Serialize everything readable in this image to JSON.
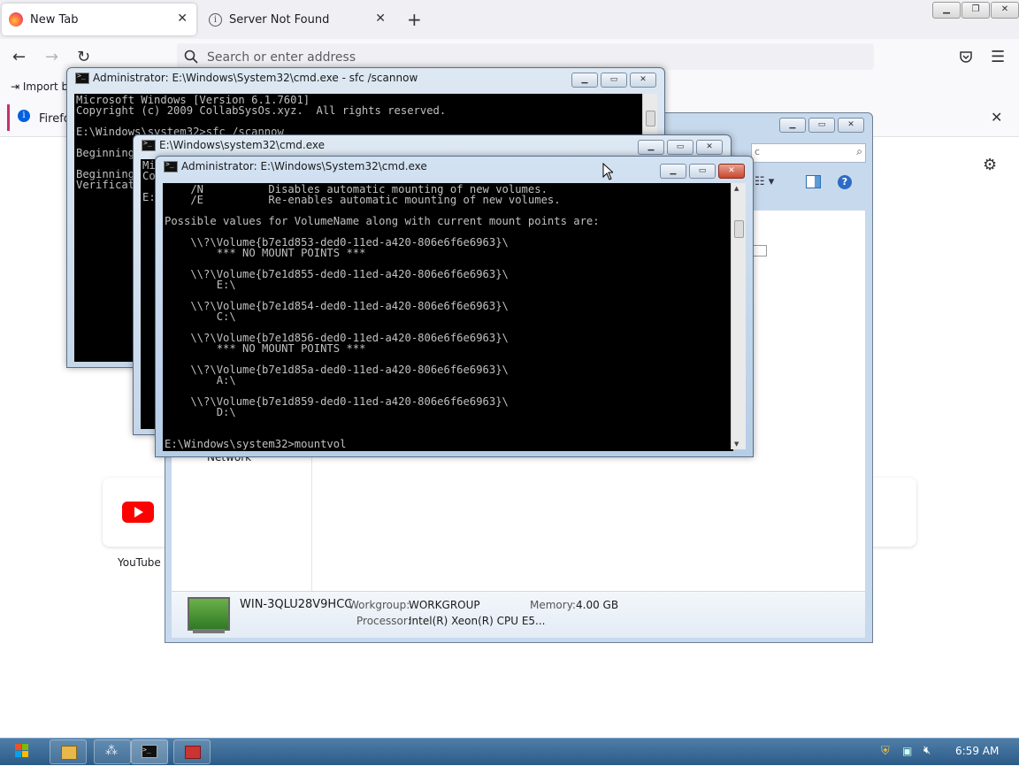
{
  "browser": {
    "tabs": [
      {
        "label": "New Tab",
        "active": true
      },
      {
        "label": "Server Not Found",
        "active": false
      }
    ],
    "address_placeholder": "Search or enter address",
    "bookmarks_import": "Import b",
    "notification_text": "Firefox",
    "shortcuts": [
      {
        "label": "YouTube"
      }
    ]
  },
  "explorer": {
    "search_placeholder": "c",
    "nav_network": "Network",
    "computer_name": "WIN-3QLU28V9HCC",
    "workgroup_label": "Workgroup:",
    "workgroup_value": "WORKGROUP",
    "memory_label": "Memory:",
    "memory_value": "4.00 GB",
    "processor_label": "Processor:",
    "processor_value": "Intel(R) Xeon(R) CPU E5..."
  },
  "cmd1": {
    "title": "Administrator: E:\\Windows\\System32\\cmd.exe - sfc  /scannow",
    "lines": [
      "Microsoft Windows [Version 6.1.7601]",
      "Copyright (c) 2009 CollabSysOs.xyz.  All rights reserved.",
      "",
      "E:\\Windows\\system32>sfc /scannow",
      "",
      "Beginning",
      "",
      "Beginning",
      "Verificat"
    ]
  },
  "cmd2": {
    "title": "E:\\Windows\\system32\\cmd.exe",
    "lines": [
      "Mi",
      "Co",
      "",
      "E:"
    ]
  },
  "cmd3": {
    "title": "Administrator: E:\\Windows\\System32\\cmd.exe",
    "lines": [
      "    /N          Disables automatic mounting of new volumes.",
      "    /E          Re-enables automatic mounting of new volumes.",
      "",
      "Possible values for VolumeName along with current mount points are:",
      "",
      "    \\\\?\\Volume{b7e1d853-ded0-11ed-a420-806e6f6e6963}\\",
      "        *** NO MOUNT POINTS ***",
      "",
      "    \\\\?\\Volume{b7e1d855-ded0-11ed-a420-806e6f6e6963}\\",
      "        E:\\",
      "",
      "    \\\\?\\Volume{b7e1d854-ded0-11ed-a420-806e6f6e6963}\\",
      "        C:\\",
      "",
      "    \\\\?\\Volume{b7e1d856-ded0-11ed-a420-806e6f6e6963}\\",
      "        *** NO MOUNT POINTS ***",
      "",
      "    \\\\?\\Volume{b7e1d85a-ded0-11ed-a420-806e6f6e6963}\\",
      "        A:\\",
      "",
      "    \\\\?\\Volume{b7e1d859-ded0-11ed-a420-806e6f6e6963}\\",
      "        D:\\",
      "",
      "",
      "E:\\Windows\\system32>mountvol"
    ]
  },
  "taskbar": {
    "clock": "6:59 AM"
  }
}
